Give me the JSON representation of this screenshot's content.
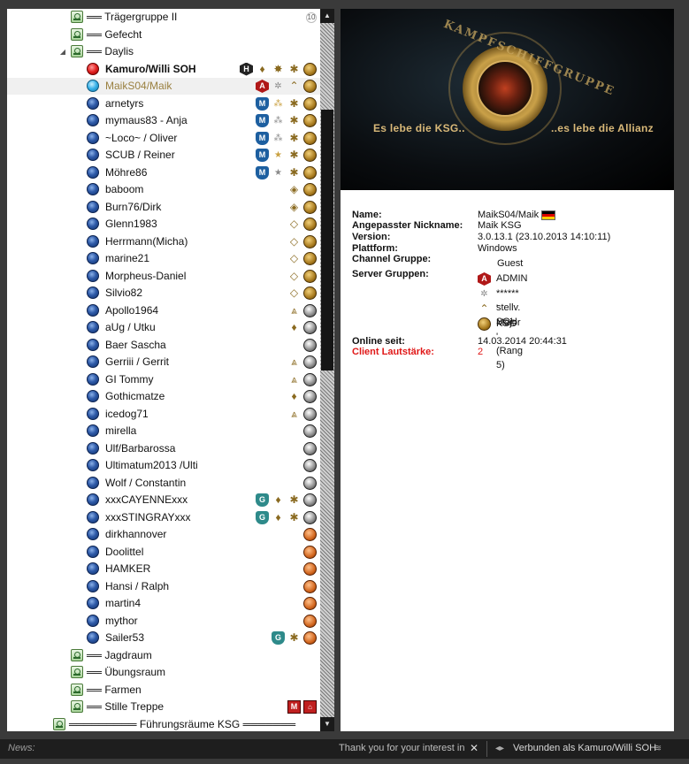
{
  "tree": {
    "rows": [
      {
        "kind": "channel",
        "label": "Trägergruppe II",
        "indent": 1,
        "badges": [
          {
            "t": "sub",
            "x": "10"
          }
        ]
      },
      {
        "kind": "channel",
        "label": "Gefecht",
        "indent": 1,
        "badges": []
      },
      {
        "kind": "channel",
        "label": "Daylis",
        "indent": 1,
        "expanded": true,
        "badges": []
      },
      {
        "kind": "client",
        "label": "Kamuro/Willi SOH",
        "status": "talk",
        "bold": true,
        "badges": [
          {
            "t": "h",
            "x": "H"
          },
          {
            "t": "rank",
            "x": "♦"
          },
          {
            "t": "rank",
            "x": "✸"
          },
          {
            "t": "rank",
            "x": "✱"
          },
          {
            "t": "ksg",
            "x": ""
          }
        ]
      },
      {
        "kind": "client",
        "label": "MaikS04/Maik",
        "status": "away",
        "selected": true,
        "badges": [
          {
            "t": "a",
            "x": "A"
          },
          {
            "t": "star gray",
            "x": "✲"
          },
          {
            "t": "rank",
            "x": "⌃"
          },
          {
            "t": "ksg",
            "x": ""
          }
        ]
      },
      {
        "kind": "client",
        "label": "arnetyrs",
        "status": "normal",
        "badges": [
          {
            "t": "m",
            "x": "M"
          },
          {
            "t": "star",
            "x": "⁂"
          },
          {
            "t": "rank",
            "x": "✱"
          },
          {
            "t": "ksg",
            "x": ""
          }
        ]
      },
      {
        "kind": "client",
        "label": "mymaus83 - Anja",
        "status": "normal",
        "badges": [
          {
            "t": "m",
            "x": "M"
          },
          {
            "t": "star gray",
            "x": "⁂"
          },
          {
            "t": "rank",
            "x": "✱"
          },
          {
            "t": "ksg",
            "x": ""
          }
        ]
      },
      {
        "kind": "client",
        "label": "~Loco~ / Oliver",
        "status": "normal",
        "badges": [
          {
            "t": "m",
            "x": "M"
          },
          {
            "t": "star gray",
            "x": "⁂"
          },
          {
            "t": "rank",
            "x": "✱"
          },
          {
            "t": "ksg",
            "x": ""
          }
        ]
      },
      {
        "kind": "client",
        "label": "SCUB / Reiner",
        "status": "normal",
        "badges": [
          {
            "t": "m",
            "x": "M"
          },
          {
            "t": "star",
            "x": "★"
          },
          {
            "t": "rank",
            "x": "✱"
          },
          {
            "t": "ksg",
            "x": ""
          }
        ]
      },
      {
        "kind": "client",
        "label": "Möhre86",
        "status": "normal",
        "badges": [
          {
            "t": "m",
            "x": "M"
          },
          {
            "t": "star gray",
            "x": "★"
          },
          {
            "t": "rank",
            "x": "✱"
          },
          {
            "t": "ksg",
            "x": ""
          }
        ]
      },
      {
        "kind": "client",
        "label": "baboom",
        "status": "normal",
        "badges": [
          {
            "t": "rank",
            "x": "◈"
          },
          {
            "t": "ksg",
            "x": ""
          }
        ]
      },
      {
        "kind": "client",
        "label": "Burn76/Dirk",
        "status": "normal",
        "badges": [
          {
            "t": "rank",
            "x": "◈"
          },
          {
            "t": "ksg",
            "x": ""
          }
        ]
      },
      {
        "kind": "client",
        "label": "Glenn1983",
        "status": "normal",
        "badges": [
          {
            "t": "rank",
            "x": "◇"
          },
          {
            "t": "ksg",
            "x": ""
          }
        ]
      },
      {
        "kind": "client",
        "label": "Herrmann(Micha)",
        "status": "normal",
        "badges": [
          {
            "t": "rank",
            "x": "◇"
          },
          {
            "t": "ksg",
            "x": ""
          }
        ]
      },
      {
        "kind": "client",
        "label": "marine21",
        "status": "normal",
        "badges": [
          {
            "t": "rank",
            "x": "◇"
          },
          {
            "t": "ksg",
            "x": ""
          }
        ]
      },
      {
        "kind": "client",
        "label": "Morpheus-Daniel",
        "status": "normal",
        "badges": [
          {
            "t": "rank",
            "x": "◇"
          },
          {
            "t": "ksg",
            "x": ""
          }
        ]
      },
      {
        "kind": "client",
        "label": "Silvio82",
        "status": "normal",
        "badges": [
          {
            "t": "rank",
            "x": "◇"
          },
          {
            "t": "ksg",
            "x": ""
          }
        ]
      },
      {
        "kind": "client",
        "label": "Apollo1964",
        "status": "normal",
        "badges": [
          {
            "t": "rank",
            "x": "⩓"
          },
          {
            "t": "ksgc",
            "x": ""
          }
        ]
      },
      {
        "kind": "client",
        "label": "aUg / Utku",
        "status": "normal",
        "badges": [
          {
            "t": "rank",
            "x": "♦"
          },
          {
            "t": "ksgc",
            "x": ""
          }
        ]
      },
      {
        "kind": "client",
        "label": "Baer Sascha",
        "status": "normal",
        "badges": [
          {
            "t": "ksgc",
            "x": ""
          }
        ]
      },
      {
        "kind": "client",
        "label": "Gerriii / Gerrit",
        "status": "normal",
        "badges": [
          {
            "t": "rank",
            "x": "⩓"
          },
          {
            "t": "ksgc",
            "x": ""
          }
        ]
      },
      {
        "kind": "client",
        "label": "GI Tommy",
        "status": "normal",
        "badges": [
          {
            "t": "rank",
            "x": "⩓"
          },
          {
            "t": "ksgc",
            "x": ""
          }
        ]
      },
      {
        "kind": "client",
        "label": "Gothicmatze",
        "status": "normal",
        "badges": [
          {
            "t": "rank",
            "x": "♦"
          },
          {
            "t": "ksgc",
            "x": ""
          }
        ]
      },
      {
        "kind": "client",
        "label": "icedog71",
        "status": "normal",
        "badges": [
          {
            "t": "rank",
            "x": "⩓"
          },
          {
            "t": "ksgc",
            "x": ""
          }
        ]
      },
      {
        "kind": "client",
        "label": "mirella",
        "status": "normal",
        "badges": [
          {
            "t": "ksgc",
            "x": ""
          }
        ]
      },
      {
        "kind": "client",
        "label": "Ulf/Barbarossa",
        "status": "normal",
        "badges": [
          {
            "t": "ksgc",
            "x": ""
          }
        ]
      },
      {
        "kind": "client",
        "label": "Ultimatum2013 /Ulti",
        "status": "normal",
        "badges": [
          {
            "t": "ksgc",
            "x": ""
          }
        ]
      },
      {
        "kind": "client",
        "label": "Wolf / Constantin",
        "status": "normal",
        "badges": [
          {
            "t": "ksgc",
            "x": ""
          }
        ]
      },
      {
        "kind": "client",
        "label": "xxxCAYENNExxx",
        "status": "normal",
        "badges": [
          {
            "t": "g",
            "x": "G"
          },
          {
            "t": "rank",
            "x": "♦"
          },
          {
            "t": "rank",
            "x": "✱"
          },
          {
            "t": "ksgc",
            "x": ""
          }
        ]
      },
      {
        "kind": "client",
        "label": "xxxSTINGRAYxxx",
        "status": "normal",
        "badges": [
          {
            "t": "g",
            "x": "G"
          },
          {
            "t": "rank",
            "x": "♦"
          },
          {
            "t": "rank",
            "x": "✱"
          },
          {
            "t": "ksgc",
            "x": ""
          }
        ]
      },
      {
        "kind": "client",
        "label": "dirkhannover",
        "status": "normal",
        "badges": [
          {
            "t": "ksgo",
            "x": ""
          }
        ]
      },
      {
        "kind": "client",
        "label": "Doolittel",
        "status": "normal",
        "badges": [
          {
            "t": "ksgo",
            "x": ""
          }
        ]
      },
      {
        "kind": "client",
        "label": "HAMKER",
        "status": "normal",
        "badges": [
          {
            "t": "ksgo",
            "x": ""
          }
        ]
      },
      {
        "kind": "client",
        "label": "Hansi / Ralph",
        "status": "normal",
        "badges": [
          {
            "t": "ksgo",
            "x": ""
          }
        ]
      },
      {
        "kind": "client",
        "label": "martin4",
        "status": "normal",
        "badges": [
          {
            "t": "ksgo",
            "x": ""
          }
        ]
      },
      {
        "kind": "client",
        "label": "mythor",
        "status": "normal",
        "badges": [
          {
            "t": "ksgo",
            "x": ""
          }
        ]
      },
      {
        "kind": "client",
        "label": "Sailer53",
        "status": "normal",
        "badges": [
          {
            "t": "g",
            "x": "G"
          },
          {
            "t": "rank",
            "x": "✱"
          },
          {
            "t": "ksgo",
            "x": ""
          }
        ]
      },
      {
        "kind": "channel",
        "label": "Jagdraum",
        "indent": 1,
        "badges": []
      },
      {
        "kind": "channel",
        "label": "Übungsraum",
        "indent": 1,
        "badges": []
      },
      {
        "kind": "channel",
        "label": "Farmen",
        "indent": 1,
        "badges": []
      },
      {
        "kind": "channel",
        "label": "Stille Treppe",
        "indent": 1,
        "badges": [
          {
            "t": "mm",
            "x": "M"
          },
          {
            "t": "mm2",
            "x": "⌂"
          }
        ]
      },
      {
        "kind": "channel",
        "label": "Führungsräume  KSG",
        "indent": 0,
        "spacer": true,
        "badges": []
      }
    ]
  },
  "info": {
    "banner": {
      "ring_text": "KAMPFSCHIFFGRUPPE",
      "slogan_left": "Es lebe die KSG..",
      "slogan_right": "..es lebe die Allianz"
    },
    "labels": {
      "name": "Name:",
      "nickname": "Angepasster Nickname:",
      "version": "Version:",
      "platform": "Plattform:",
      "channel_group": "Channel Gruppe:",
      "server_groups": "Server Gruppen:",
      "online": "Online seit:",
      "volume": "Client Lautstärke:"
    },
    "values": {
      "name": "MaikS04/Maik",
      "nickname": "Maik KSG",
      "version": "3.0.13.1 (23.10.2013 14:10:11)",
      "platform": "Windows",
      "channel_group": "Guest",
      "server_groups": [
        "ADMIN",
        "****** stellv. SOH",
        "' Major ' (Rang 5)",
        "KSG"
      ],
      "online": "14.03.2014 20:44:31",
      "volume": "2"
    }
  },
  "statusbar": {
    "news_label": "News:",
    "news_text": "Thank you for your interest in",
    "connection": "Verbunden als Kamuro/Willi SOH"
  },
  "colors": {
    "background": "#2b2b2b",
    "accent_gold": "#c9a048",
    "volume_red": "#e01818"
  }
}
